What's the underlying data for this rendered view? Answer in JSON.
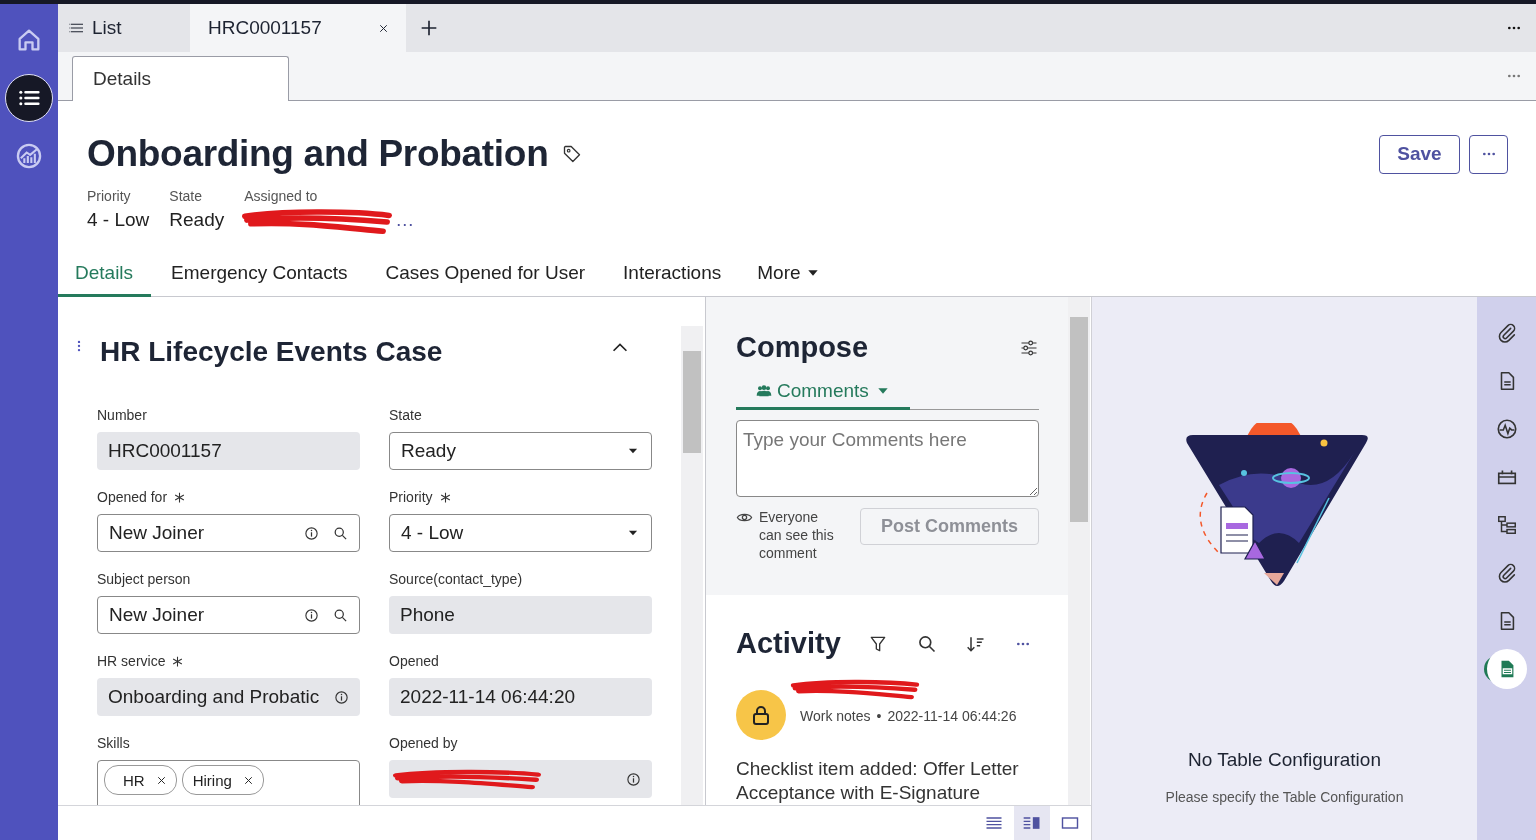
{
  "nav_rail": [
    {
      "kind": "home",
      "selected": false
    },
    {
      "kind": "list",
      "selected": true
    },
    {
      "kind": "analytics",
      "selected": false
    }
  ],
  "tabs": [
    {
      "label": "List",
      "kind": "list",
      "selected": false
    },
    {
      "label": "HRC0001157",
      "kind": "record",
      "selected": true
    }
  ],
  "subtabs": [
    {
      "label": "Details",
      "selected": true
    }
  ],
  "record": {
    "title": "Onboarding and Probation",
    "save_button": "Save",
    "meta": [
      {
        "label": "Priority",
        "value": "4 - Low",
        "kind": "text"
      },
      {
        "label": "State",
        "value": "Ready",
        "kind": "text"
      },
      {
        "label": "Assigned to",
        "value": "…",
        "kind": "redacted"
      }
    ]
  },
  "section_tabs": [
    {
      "label": "Details",
      "selected": true,
      "kind": "tab"
    },
    {
      "label": "Emergency Contacts",
      "selected": false,
      "kind": "tab"
    },
    {
      "label": "Cases Opened for User",
      "selected": false,
      "kind": "tab"
    },
    {
      "label": "Interactions",
      "selected": false,
      "kind": "tab"
    },
    {
      "label": "More",
      "selected": false,
      "kind": "menu"
    }
  ],
  "form": {
    "title": "HR Lifecycle Events Case",
    "expanded": true,
    "fields": [
      {
        "label": "Number",
        "required": false,
        "kind": "readonly",
        "value": "HRC0001157"
      },
      {
        "label": "State",
        "required": false,
        "kind": "select",
        "value": "Ready"
      },
      {
        "label": "Opened for",
        "required": true,
        "kind": "reference",
        "value": "New Joiner"
      },
      {
        "label": "Priority",
        "required": true,
        "kind": "select",
        "value": "4 - Low"
      },
      {
        "label": "Subject person",
        "required": false,
        "kind": "reference",
        "value": "New Joiner"
      },
      {
        "label": "Source(contact_type)",
        "required": false,
        "kind": "readonly",
        "value": "Phone"
      },
      {
        "label": "HR service",
        "required": true,
        "kind": "readonly_info",
        "value": "Onboarding and Probatic"
      },
      {
        "label": "Opened",
        "required": false,
        "kind": "readonly",
        "value": "2022-11-14 06:44:20"
      },
      {
        "label": "Skills",
        "required": false,
        "kind": "tags",
        "tags": [
          "HR",
          "Hiring"
        ]
      },
      {
        "label": "Opened by",
        "required": false,
        "kind": "redacted_info"
      }
    ]
  },
  "compose": {
    "title": "Compose",
    "mode": "Comments",
    "placeholder": "Type your Comments here",
    "visibility_note": "Everyone can see this comment",
    "post_button": {
      "label": "Post Comments",
      "disabled": true
    }
  },
  "activity": {
    "title": "Activity",
    "entries": [
      {
        "kind": "locked",
        "type": "Work notes",
        "separator": "•",
        "time": "2022-11-14 06:44:26",
        "text": "Checklist item added: Offer Letter Acceptance with E-Signature"
      }
    ]
  },
  "empty_state": {
    "title": "No Table Configuration",
    "message": "Please specify the Table Configuration"
  },
  "side_rail": [
    {
      "kind": "attachment",
      "selected": false
    },
    {
      "kind": "document",
      "selected": false
    },
    {
      "kind": "pulse",
      "selected": false
    },
    {
      "kind": "calendar",
      "selected": false
    },
    {
      "kind": "tree",
      "selected": false
    },
    {
      "kind": "attachment",
      "selected": false
    },
    {
      "kind": "document",
      "selected": false
    },
    {
      "kind": "sheet",
      "selected": true
    }
  ],
  "view_modes": [
    {
      "kind": "list",
      "selected": false
    },
    {
      "kind": "split",
      "selected": true
    },
    {
      "kind": "single",
      "selected": false
    }
  ]
}
